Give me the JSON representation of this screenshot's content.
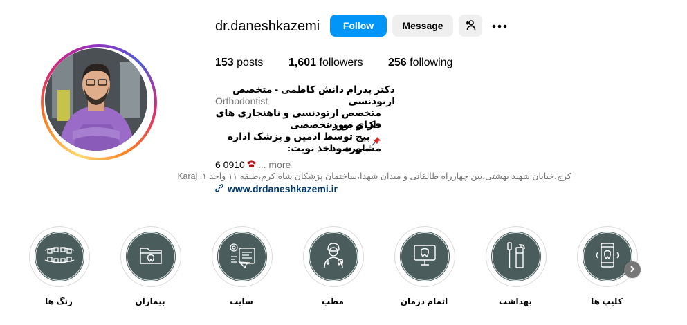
{
  "profile": {
    "username": "dr.daneshkazemi",
    "follow_label": "Follow",
    "message_label": "Message",
    "posts_count": "153",
    "posts_label": "posts",
    "followers_count": "1,601",
    "followers_label": "followers",
    "following_count": "256",
    "following_label": "following"
  },
  "bio": {
    "name": "دکتر پدرام دانش کاظمی - متخصص ارتودنسی",
    "category": "Orthodontist",
    "line1": "متخصص ارتودنسی و ناهنجاری های فک و صورت",
    "line2": "دارای بورد تخصصی",
    "line3": "پیج توسط ادمین و پزشک اداره می شود.",
    "line4": "مشاوره و اخذ نوبت:",
    "phone": "6 0910",
    "more_label": "... more",
    "address": "کرج،خیابان شهید بهشتی،بین چهارراه طالقانی و میدان شهدا،ساختمان پزشکان شاه کرم،طبقه ۱۱ واحد ۱. Karaj",
    "website": "www.drdaneshkazemi.ir"
  },
  "highlights": [
    {
      "label": "رنگ ها",
      "icon": "braces-icon"
    },
    {
      "label": "بیماران",
      "icon": "patient-folder-icon"
    },
    {
      "label": "سایت",
      "icon": "website-icon"
    },
    {
      "label": "مطب",
      "icon": "dentist-icon"
    },
    {
      "label": "اتمام درمان",
      "icon": "treatment-complete-icon"
    },
    {
      "label": "بهداشت",
      "icon": "hygiene-icon"
    },
    {
      "label": "کلیپ ها",
      "icon": "clip-phone-icon"
    }
  ],
  "colors": {
    "follow_blue": "#0095f6",
    "highlight_bg": "#4a5c5c",
    "link": "#00376b"
  }
}
